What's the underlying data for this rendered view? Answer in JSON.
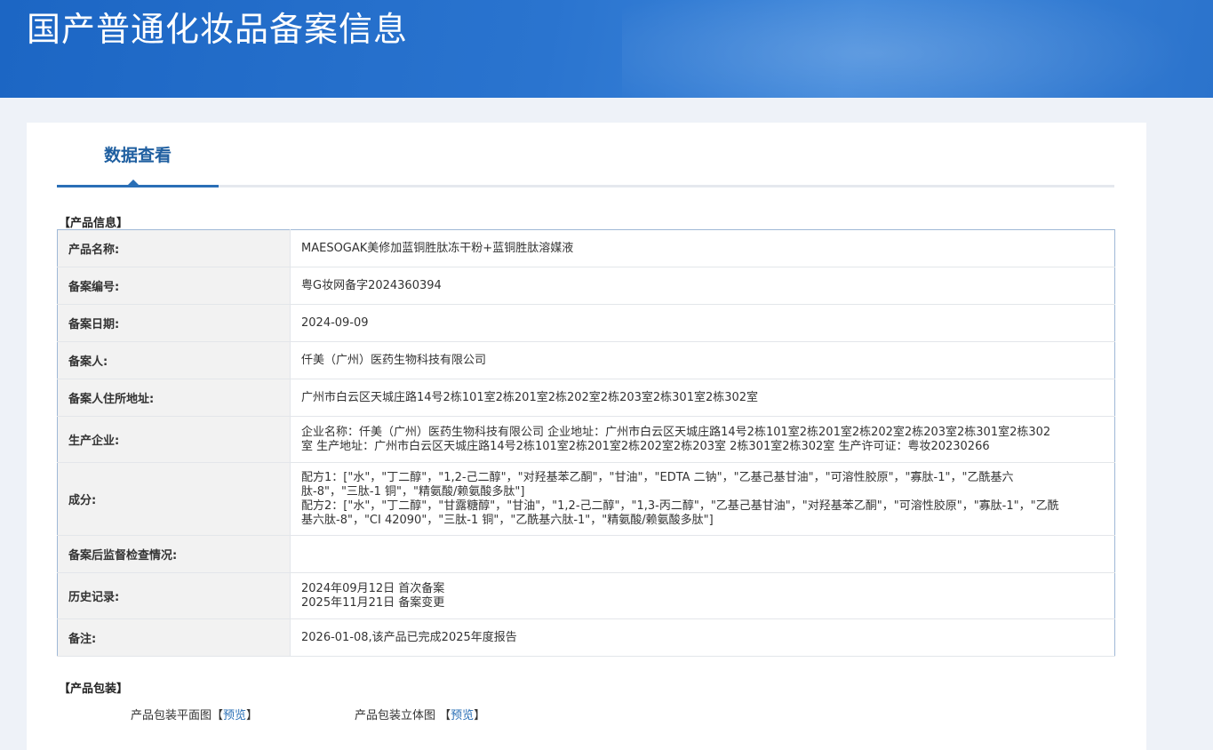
{
  "header": {
    "title": "国产普通化妆品备案信息"
  },
  "tabs": [
    {
      "label": "数据查看"
    }
  ],
  "product_info": {
    "section_title": "【产品信息】",
    "rows": [
      {
        "label": "产品名称:",
        "value": "MAESOGAK美修加蓝铜胜肽冻干粉+蓝铜胜肽溶媒液"
      },
      {
        "label": "备案编号:",
        "value": "粤G妆网备字2024360394"
      },
      {
        "label": "备案日期:",
        "value": "2024-09-09"
      },
      {
        "label": "备案人:",
        "value": "仟美（广州）医药生物科技有限公司"
      },
      {
        "label": "备案人住所地址:",
        "value": "广州市白云区天城庄路14号2栋101室2栋201室2栋202室2栋203室2栋301室2栋302室"
      },
      {
        "label": "生产企业:",
        "value": "企业名称：仟美（广州）医药生物科技有限公司 企业地址：广州市白云区天城庄路14号2栋101室2栋201室2栋202室2栋203室2栋301室2栋302室 生产地址：广州市白云区天城庄路14号2栋101室2栋201室2栋202室2栋203室 2栋301室2栋302室 生产许可证：粤妆20230266"
      },
      {
        "label": "成分:",
        "lines": [
          "配方1：[\"水\"，\"丁二醇\"，\"1,2-己二醇\"，\"对羟基苯乙酮\"，\"甘油\"，\"EDTA 二钠\"，\"乙基己基甘油\"，\"可溶性胶原\"，\"寡肽-1\"，\"乙酰基六肽-8\"，\"三肽-1 铜\"，\"精氨酸/赖氨酸多肽\"]",
          "配方2：[\"水\"，\"丁二醇\"，\"甘露糖醇\"，\"甘油\"，\"1,2-己二醇\"，\"1,3-丙二醇\"，\"乙基己基甘油\"，\"对羟基苯乙酮\"，\"可溶性胶原\"，\"寡肽-1\"，\"乙酰基六肽-8\"，\"CI 42090\"，\"三肽-1 铜\"，\"乙酰基六肽-1\"，\"精氨酸/赖氨酸多肽\"]"
        ]
      },
      {
        "label": "备案后监督检查情况:",
        "value": ""
      },
      {
        "label": "历史记录:",
        "lines": [
          "2024年09月12日 首次备案",
          "2025年11月21日 备案变更"
        ]
      },
      {
        "label": "备注:",
        "value": "2026-01-08,该产品已完成2025年度报告"
      }
    ]
  },
  "packaging": {
    "section_title": "【产品包装】",
    "items": [
      {
        "label": "产品包装平面图",
        "link": "预览"
      },
      {
        "label": "产品包装立体图",
        "link": "预览"
      }
    ]
  }
}
